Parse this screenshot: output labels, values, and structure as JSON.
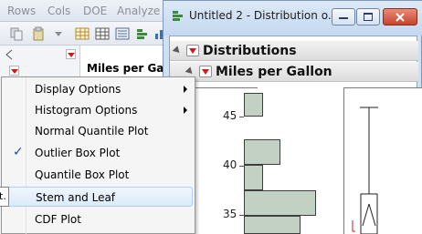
{
  "background_window": {
    "menu_items": [
      "Rows",
      "Cols",
      "DOE",
      "Analyze"
    ],
    "column_header": "Miles per Gallo"
  },
  "distribution_window": {
    "title": "Untitled 2 - Distribution o...",
    "outline": {
      "distributions_label": "Distributions",
      "variable_label": "Miles per Gallon"
    },
    "axis": {
      "tick_labels": [
        "45",
        "40",
        "35"
      ]
    },
    "colors": {
      "histogram_fill": "#c3d1c5",
      "red_triangle": "#d11a1a"
    }
  },
  "context_menu": {
    "items": [
      {
        "label": "Display Options",
        "submenu": true,
        "checked": false,
        "highlighted": false
      },
      {
        "label": "Histogram Options",
        "submenu": true,
        "checked": false,
        "highlighted": false
      },
      {
        "label": "Normal Quantile Plot",
        "submenu": false,
        "checked": false,
        "highlighted": false
      },
      {
        "label": "Outlier Box Plot",
        "submenu": false,
        "checked": true,
        "highlighted": false
      },
      {
        "label": "Quantile Box Plot",
        "submenu": false,
        "checked": false,
        "highlighted": false
      },
      {
        "label": "Stem and Leaf",
        "submenu": false,
        "checked": false,
        "highlighted": true
      },
      {
        "label": "CDF Plot",
        "submenu": false,
        "checked": false,
        "highlighted": false
      }
    ],
    "check_glyph": "✓",
    "tooltip_text": "t."
  }
}
